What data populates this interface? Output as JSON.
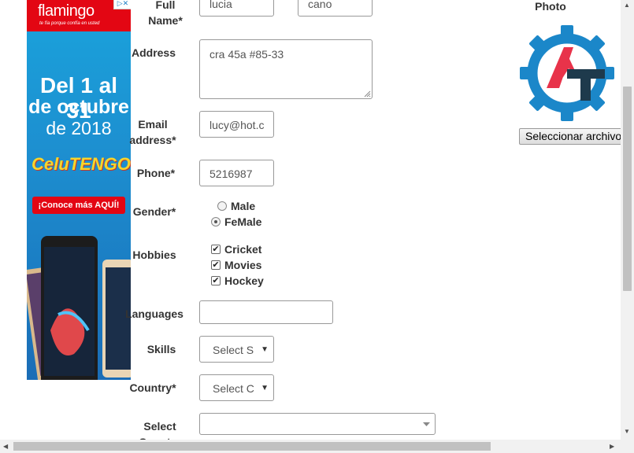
{
  "ad": {
    "brand": "flamingo",
    "slogan": "te fía porque confía en usted",
    "close_label": "▷✕",
    "line1": "Del 1 al 31",
    "line2": "de octubre",
    "line3": "de 2018",
    "promo": "CeluTENGO",
    "cta": "¡Conoce más AQUÍ!"
  },
  "form": {
    "full_name_label": "Full\nName*",
    "first_name_value": "lucia",
    "last_name_value": "cano",
    "address_label": "Address",
    "address_value": "cra 45a #85-33",
    "email_label": "Email\naddress*",
    "email_value": "lucy@hot.c",
    "phone_label": "Phone*",
    "phone_value": "5216987",
    "gender_label": "Gender*",
    "gender_options": [
      {
        "label": "Male",
        "selected": false
      },
      {
        "label": "FeMale",
        "selected": true
      }
    ],
    "hobbies_label": "Hobbies",
    "hobbies": [
      {
        "label": "Cricket",
        "checked": true
      },
      {
        "label": "Movies",
        "checked": true
      },
      {
        "label": "Hockey",
        "checked": true
      }
    ],
    "languages_label": "Languages",
    "languages_value": "",
    "skills_label": "Skills",
    "skills_value": "Select S",
    "country_label": "Country*",
    "country_value": "Select C",
    "select_country_label": "Select\nCountry"
  },
  "photo": {
    "label": "Photo",
    "logo_letters": "AT",
    "file_button": "Seleccionar archivo"
  },
  "colors": {
    "logo_blue": "#1b87c9",
    "logo_red": "#e8334a",
    "logo_dark": "#1e3a4c",
    "ad_red": "#e30613",
    "ad_blue": "#1aa3dc"
  }
}
